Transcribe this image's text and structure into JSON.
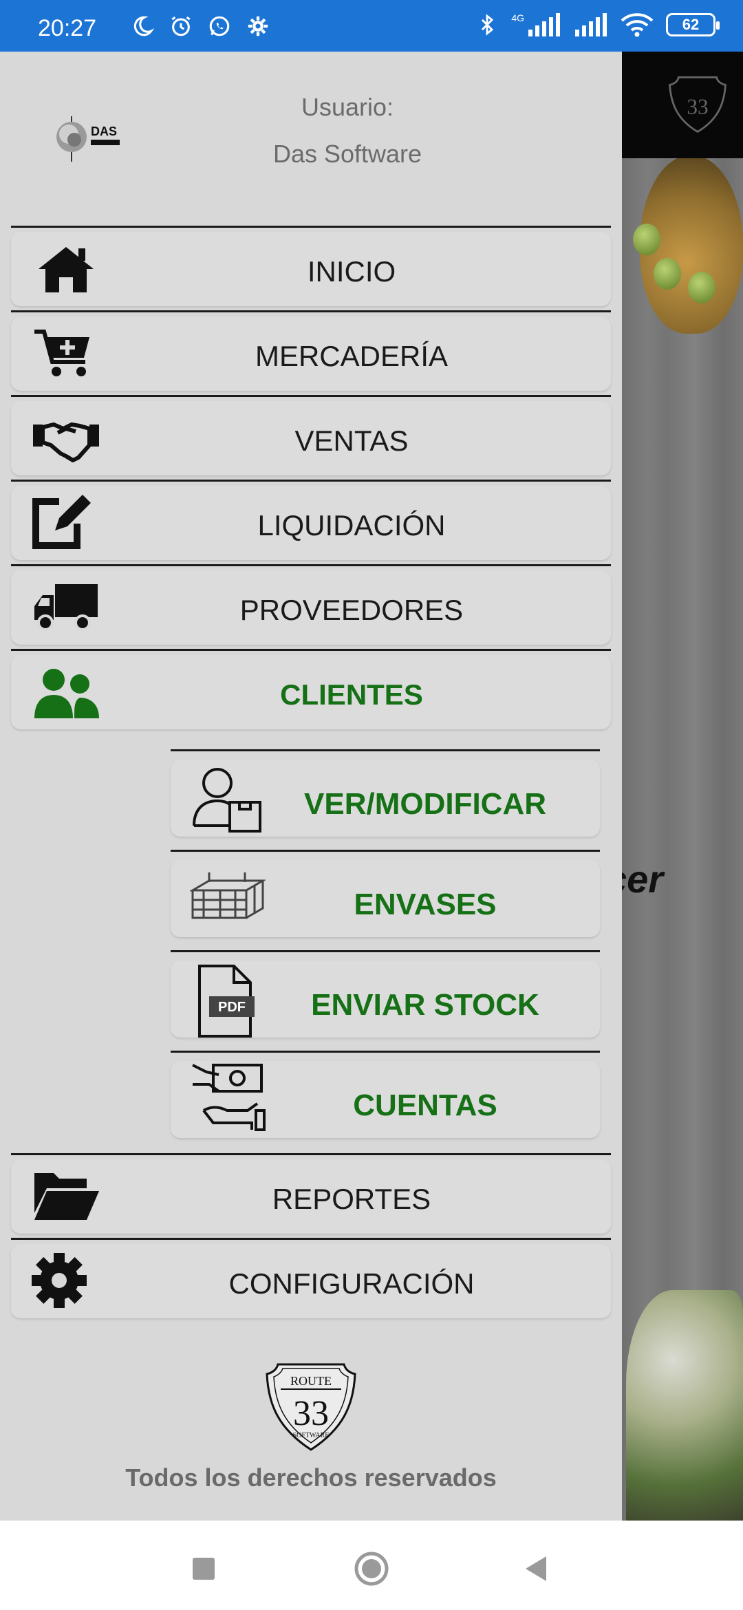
{
  "status_bar": {
    "time": "20:27",
    "network": "4G",
    "battery": "62",
    "icons_left": [
      "moon-icon",
      "alarm-icon",
      "whatsapp-icon",
      "settings-icon"
    ],
    "icons_right": [
      "bluetooth-icon",
      "signal-icon",
      "signal-icon",
      "wifi-icon",
      "battery-icon"
    ],
    "color": "#1c74d4"
  },
  "background_app": {
    "partial_text": "cer"
  },
  "drawer": {
    "user_label": "Usuario:",
    "user_name": "Das Software",
    "logo_text": "DAS",
    "menu": [
      {
        "label": "INICIO",
        "icon": "home-icon"
      },
      {
        "label": "MERCADERÍA",
        "icon": "cart-add-icon"
      },
      {
        "label": "VENTAS",
        "icon": "handshake-icon"
      },
      {
        "label": "LIQUIDACIÓN",
        "icon": "edit-icon"
      },
      {
        "label": "PROVEEDORES",
        "icon": "truck-icon"
      },
      {
        "label": "CLIENTES",
        "icon": "users-icon",
        "active": true
      }
    ],
    "submenu": [
      {
        "label": "VER/MODIFICAR",
        "icon": "user-box-icon"
      },
      {
        "label": "ENVASES",
        "icon": "crate-icon"
      },
      {
        "label": "ENVIAR STOCK",
        "icon": "pdf-icon",
        "icon_text": "PDF"
      },
      {
        "label": "CUENTAS",
        "icon": "money-hand-icon"
      }
    ],
    "menu_bottom": [
      {
        "label": "REPORTES",
        "icon": "folder-open-icon"
      },
      {
        "label": "CONFIGURACIÓN",
        "icon": "gear-icon"
      }
    ],
    "footer_logo": {
      "line1": "ROUTE",
      "line2": "33",
      "line3": "SOFTWARE"
    },
    "footer_text": "Todos los derechos reservados"
  },
  "colors": {
    "accent_green": "#157016",
    "drawer_bg": "#d8d8d8"
  }
}
